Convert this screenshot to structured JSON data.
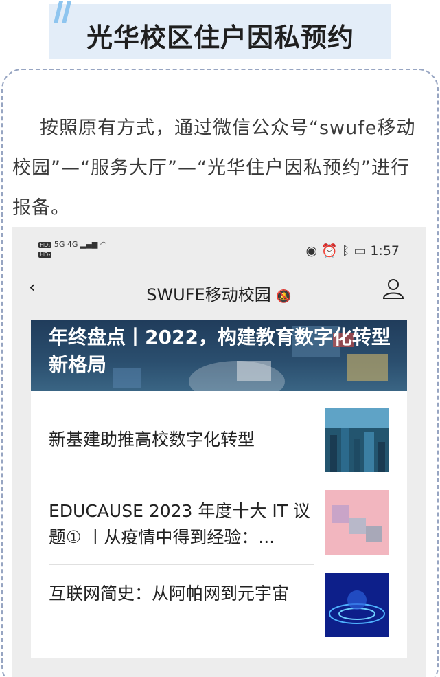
{
  "header": {
    "title": "光华校区住户因私预约"
  },
  "paragraph": {
    "text": "按照原有方式，通过微信公众号“swufe移动校园”—“服务大厅”—“光华住户因私预约”进行报备。"
  },
  "phone": {
    "status_bar": {
      "network": "5G 4G",
      "time": "1:57"
    },
    "nav": {
      "title": "SWUFE移动校园"
    },
    "banner": {
      "title": "年终盘点丨2022，构建教育数字化转型新格局"
    },
    "articles": [
      {
        "title": "新基建助推高校数字化转型",
        "thumb": "city-network-image"
      },
      {
        "title": "EDUCAUSE 2023 年度十大 IT 议题① 丨从疫情中得到经验：...",
        "thumb": "cubes-image"
      },
      {
        "title": "互联网简史：从阿帕网到元宇宙",
        "thumb": "blue-tech-image"
      }
    ]
  },
  "colors": {
    "title_bg": "#e3edf8",
    "dash_border": "#97a5c2",
    "accent_blue": "#8ec5ef"
  }
}
